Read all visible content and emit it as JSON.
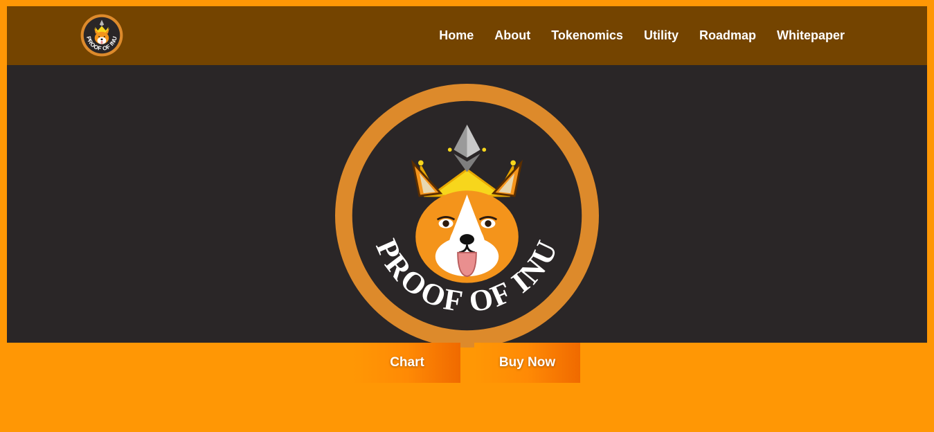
{
  "colors": {
    "page_background": "#FF9705",
    "header_background": "#744400",
    "hero_background": "#2A2627",
    "logo_ring": "#DD8A2B",
    "crown": "#F7D61C",
    "button_gradient_end": "#F06A00"
  },
  "header": {
    "logo_text": "PROOF OF INU",
    "nav": [
      "Home",
      "About",
      "Tokenomics",
      "Utility",
      "Roadmap",
      "Whitepaper"
    ]
  },
  "hero": {
    "logo_text": "PROOF OF INU",
    "buttons": {
      "chart_label": "Chart",
      "buy_label": "Buy Now"
    }
  }
}
